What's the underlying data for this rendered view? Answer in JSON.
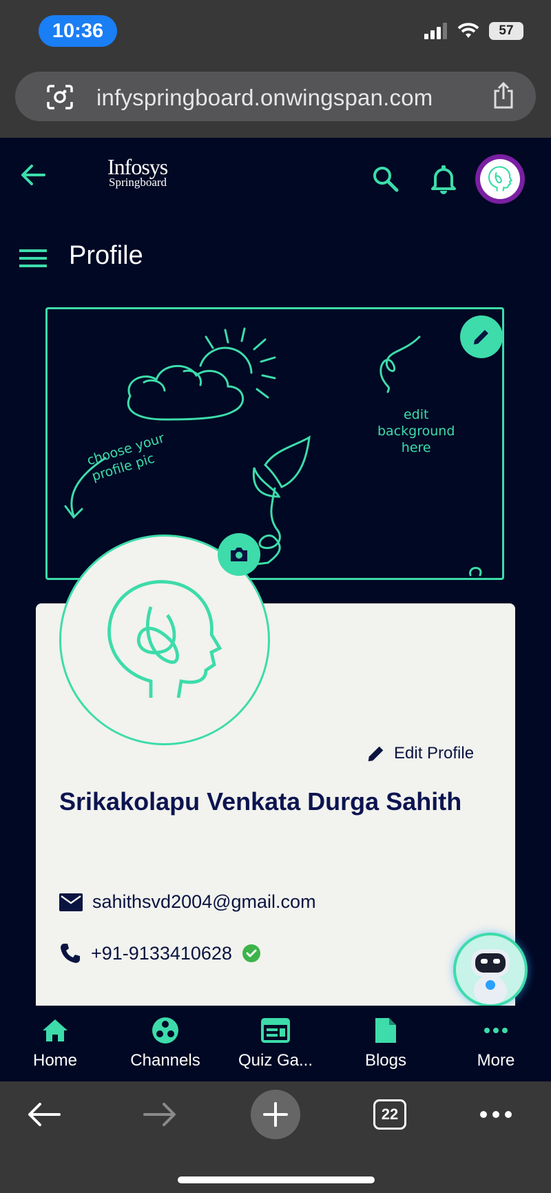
{
  "status_bar": {
    "time": "10:36",
    "battery": "57"
  },
  "browser": {
    "url": "infyspringboard.onwingspan.com",
    "tab_count": "22"
  },
  "header": {
    "logo_line1": "Infosys",
    "logo_line2": "Springboard"
  },
  "page": {
    "title": "Profile"
  },
  "banner": {
    "hint_profile_pic": "choose your\nprofile pic",
    "hint_background": "edit\nbackground\nhere"
  },
  "profile": {
    "edit_label": "Edit Profile",
    "name": "Srikakolapu Venkata Durga Sahith",
    "email": "sahithsvd2004@gmail.com",
    "phone": "+91-9133410628"
  },
  "bottom_nav": [
    {
      "label": "Home",
      "icon": "home-icon"
    },
    {
      "label": "Channels",
      "icon": "channels-icon"
    },
    {
      "label": "Quiz Ga...",
      "icon": "quiz-icon"
    },
    {
      "label": "Blogs",
      "icon": "document-icon"
    },
    {
      "label": "More",
      "icon": "more-dots-icon"
    }
  ],
  "colors": {
    "accent": "#3ddcaa",
    "background": "#000824",
    "card": "#f2f2ee",
    "text_dark": "#0c1450",
    "verified": "#3cb44a"
  }
}
